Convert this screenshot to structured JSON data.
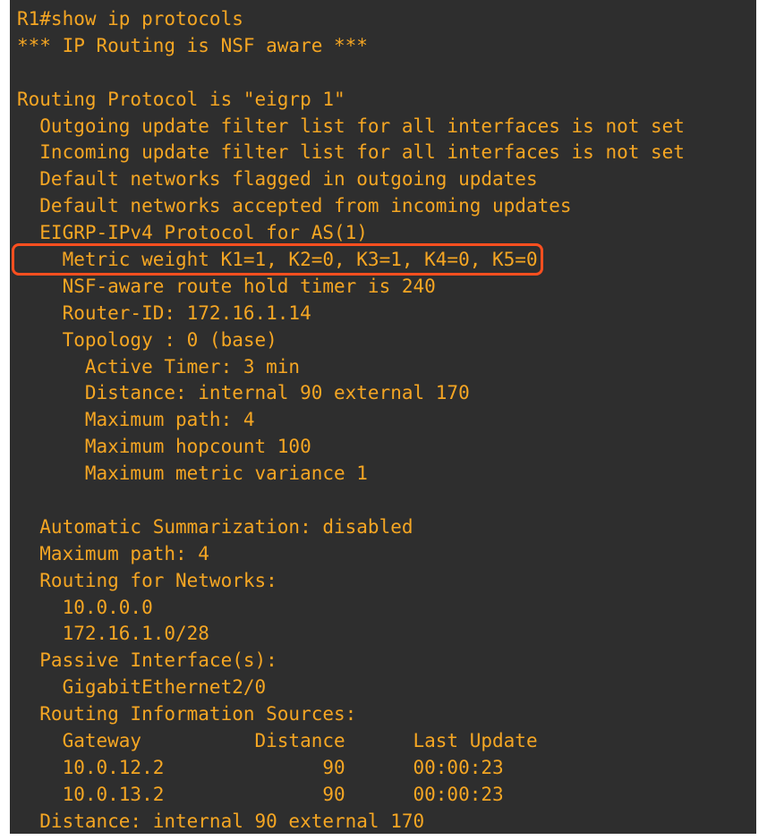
{
  "terminal": {
    "lines": [
      {
        "text": "R1#show ip protocols"
      },
      {
        "text": "*** IP Routing is NSF aware ***"
      },
      {
        "text": ""
      },
      {
        "text": "Routing Protocol is \"eigrp 1\""
      },
      {
        "text": "  Outgoing update filter list for all interfaces is not set"
      },
      {
        "text": "  Incoming update filter list for all interfaces is not set"
      },
      {
        "text": "  Default networks flagged in outgoing updates"
      },
      {
        "text": "  Default networks accepted from incoming updates"
      },
      {
        "text": "  EIGRP-IPv4 Protocol for AS(1)"
      },
      {
        "text": "    Metric weight K1=1, K2=0, K3=1, K4=0, K5=0",
        "highlight": true
      },
      {
        "text": "    NSF-aware route hold timer is 240"
      },
      {
        "text": "    Router-ID: 172.16.1.14"
      },
      {
        "text": "    Topology : 0 (base)"
      },
      {
        "text": "      Active Timer: 3 min"
      },
      {
        "text": "      Distance: internal 90 external 170"
      },
      {
        "text": "      Maximum path: 4"
      },
      {
        "text": "      Maximum hopcount 100"
      },
      {
        "text": "      Maximum metric variance 1"
      },
      {
        "text": ""
      },
      {
        "text": "  Automatic Summarization: disabled"
      },
      {
        "text": "  Maximum path: 4"
      },
      {
        "text": "  Routing for Networks:"
      },
      {
        "text": "    10.0.0.0"
      },
      {
        "text": "    172.16.1.0/28"
      },
      {
        "text": "  Passive Interface(s):"
      },
      {
        "text": "    GigabitEthernet2/0"
      },
      {
        "text": "  Routing Information Sources:"
      },
      {
        "text": "    Gateway          Distance      Last Update"
      },
      {
        "text": "    10.0.12.2              90      00:00:23"
      },
      {
        "text": "    10.0.13.2              90      00:00:23"
      },
      {
        "text": "  Distance: internal 90 external 170"
      }
    ],
    "colors": {
      "background": "#2e2e2e",
      "text": "#f5a623",
      "highlight_box": "#ff4f1f"
    }
  }
}
